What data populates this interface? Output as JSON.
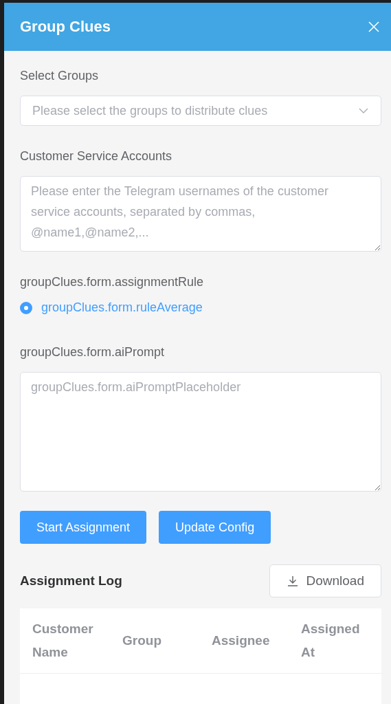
{
  "dialog": {
    "title": "Group Clues"
  },
  "form": {
    "groups": {
      "label": "Select Groups",
      "placeholder": "Please select the groups to distribute clues"
    },
    "accounts": {
      "label": "Customer Service Accounts",
      "placeholder": "Please enter the Telegram usernames of the customer service accounts, separated by commas, @name1,@name2,..."
    },
    "rule": {
      "label": "groupClues.form.assignmentRule",
      "options": [
        {
          "label": "groupClues.form.ruleAverage",
          "selected": true
        }
      ]
    },
    "prompt": {
      "label": "groupClues.form.aiPrompt",
      "placeholder": "groupClues.form.aiPromptPlaceholder"
    }
  },
  "buttons": [
    "Start Assignment",
    "Update Config"
  ],
  "log": {
    "title": "Assignment Log",
    "download": "Download",
    "columns": [
      "Customer Name",
      "Group",
      "Assignee",
      "Assigned At"
    ]
  }
}
